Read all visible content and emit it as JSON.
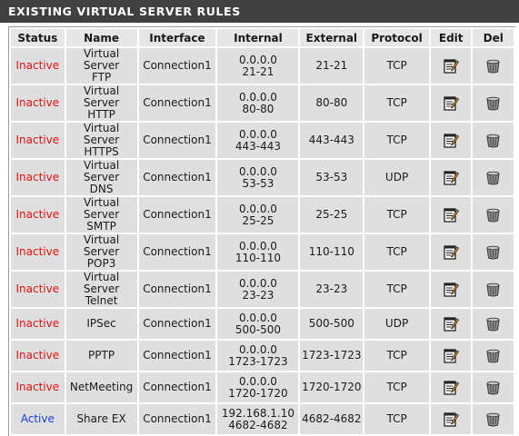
{
  "panel": {
    "title": "EXISTING VIRTUAL SERVER RULES"
  },
  "columns": [
    "Status",
    "Name",
    "Interface",
    "Internal",
    "External",
    "Protocol",
    "Edit",
    "Del"
  ],
  "rows": [
    {
      "status": "Inactive",
      "name_1": "Virtual Server",
      "name_2": "FTP",
      "interface": "Connection1",
      "internal_ip": "0.0.0.0",
      "internal_ports": "21-21",
      "external": "21-21",
      "protocol": "TCP"
    },
    {
      "status": "Inactive",
      "name_1": "Virtual Server",
      "name_2": "HTTP",
      "interface": "Connection1",
      "internal_ip": "0.0.0.0",
      "internal_ports": "80-80",
      "external": "80-80",
      "protocol": "TCP"
    },
    {
      "status": "Inactive",
      "name_1": "Virtual Server",
      "name_2": "HTTPS",
      "interface": "Connection1",
      "internal_ip": "0.0.0.0",
      "internal_ports": "443-443",
      "external": "443-443",
      "protocol": "TCP"
    },
    {
      "status": "Inactive",
      "name_1": "Virtual Server",
      "name_2": "DNS",
      "interface": "Connection1",
      "internal_ip": "0.0.0.0",
      "internal_ports": "53-53",
      "external": "53-53",
      "protocol": "UDP"
    },
    {
      "status": "Inactive",
      "name_1": "Virtual Server",
      "name_2": "SMTP",
      "interface": "Connection1",
      "internal_ip": "0.0.0.0",
      "internal_ports": "25-25",
      "external": "25-25",
      "protocol": "TCP"
    },
    {
      "status": "Inactive",
      "name_1": "Virtual Server",
      "name_2": "POP3",
      "interface": "Connection1",
      "internal_ip": "0.0.0.0",
      "internal_ports": "110-110",
      "external": "110-110",
      "protocol": "TCP"
    },
    {
      "status": "Inactive",
      "name_1": "Virtual Server",
      "name_2": "Telnet",
      "interface": "Connection1",
      "internal_ip": "0.0.0.0",
      "internal_ports": "23-23",
      "external": "23-23",
      "protocol": "TCP"
    },
    {
      "status": "Inactive",
      "name_1": "IPSec",
      "name_2": "",
      "interface": "Connection1",
      "internal_ip": "0.0.0.0",
      "internal_ports": "500-500",
      "external": "500-500",
      "protocol": "UDP"
    },
    {
      "status": "Inactive",
      "name_1": "PPTP",
      "name_2": "",
      "interface": "Connection1",
      "internal_ip": "0.0.0.0",
      "internal_ports": "1723-1723",
      "external": "1723-1723",
      "protocol": "TCP"
    },
    {
      "status": "Inactive",
      "name_1": "NetMeeting",
      "name_2": "",
      "interface": "Connection1",
      "internal_ip": "0.0.0.0",
      "internal_ports": "1720-1720",
      "external": "1720-1720",
      "protocol": "TCP"
    },
    {
      "status": "Active",
      "name_1": "Share EX",
      "name_2": "",
      "interface": "Connection1",
      "internal_ip": "192.168.1.10",
      "internal_ports": "4682-4682",
      "external": "4682-4682",
      "protocol": "TCP"
    }
  ],
  "icons": {
    "edit": "edit-notepad-icon",
    "delete": "trash-can-icon"
  },
  "colors": {
    "header_bg": "#404040",
    "cell_bg": "#dfdfdf",
    "inactive": "#e01010",
    "active": "#1a3cd8"
  }
}
